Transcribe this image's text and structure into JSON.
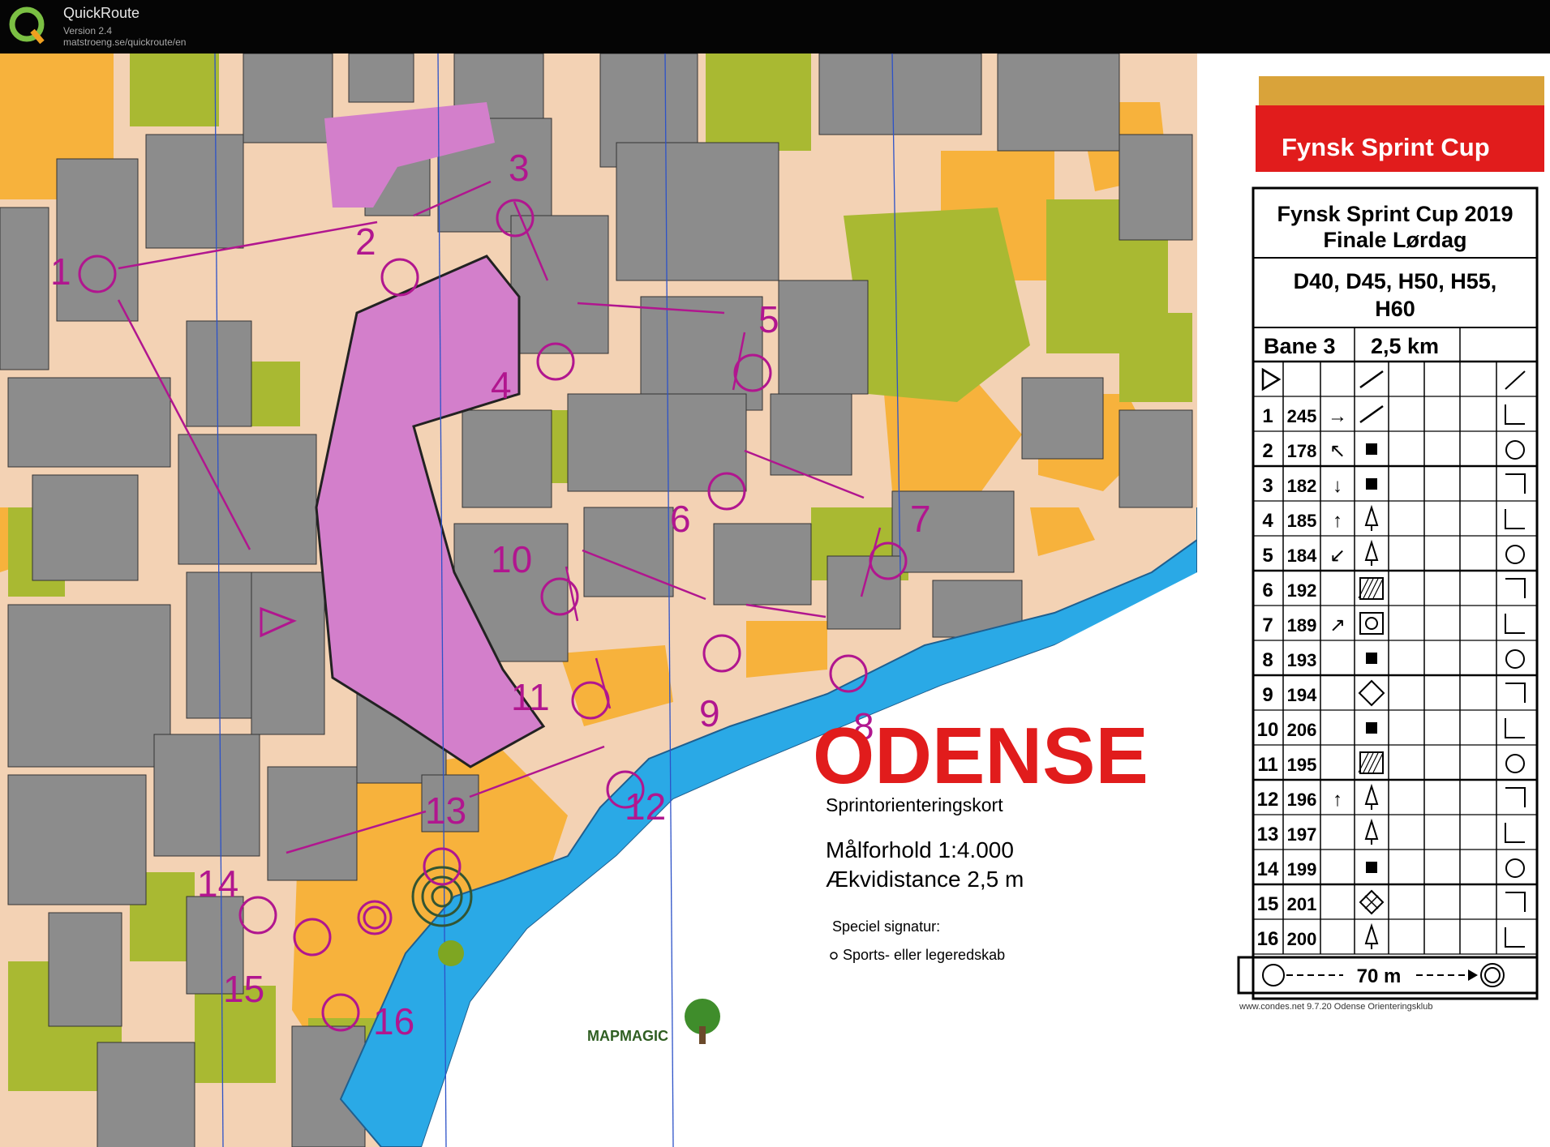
{
  "window": {
    "title": "QuickRoute",
    "version": "Version 2.4",
    "url": "matstroeng.se/quickroute/en"
  },
  "map": {
    "banner": "Fynsk Sprint Cup",
    "event_title_1": "Fynsk Sprint Cup 2019",
    "event_title_2": "Finale Lørdag",
    "classes_1": "D40, D45, H50, H55,",
    "classes_2": "H60",
    "course_name": "Bane 3",
    "course_length": "2,5 km",
    "city": "ODENSE",
    "map_type": "Sprintorienteringskort",
    "scale": "Målforhold 1:4.000",
    "contour": "Ækvidistance 2,5 m",
    "special_symbol_title": "Speciel signatur:",
    "special_symbol_desc": "Sports- eller legeredskab",
    "footer": "www.condes.net 9.7.20 Odense Orienteringsklub",
    "finish_distance": "70 m",
    "mapper_logo": "MAPMAGIC",
    "controls": [
      {
        "n": "1",
        "code": "245"
      },
      {
        "n": "2",
        "code": "178"
      },
      {
        "n": "3",
        "code": "182"
      },
      {
        "n": "4",
        "code": "185"
      },
      {
        "n": "5",
        "code": "184"
      },
      {
        "n": "6",
        "code": "192"
      },
      {
        "n": "7",
        "code": "189"
      },
      {
        "n": "8",
        "code": "193"
      },
      {
        "n": "9",
        "code": "194"
      },
      {
        "n": "10",
        "code": "206"
      },
      {
        "n": "11",
        "code": "195"
      },
      {
        "n": "12",
        "code": "196"
      },
      {
        "n": "13",
        "code": "197"
      },
      {
        "n": "14",
        "code": "199"
      },
      {
        "n": "15",
        "code": "201"
      },
      {
        "n": "16",
        "code": "200"
      }
    ],
    "colors": {
      "building": "#8c8c8c",
      "paved": "#f3d2b4",
      "open": "#f7b23c",
      "green": "#a9b932",
      "water": "#2aa9e6",
      "restricted": "#d37fcb",
      "course": "#b1168f",
      "banner_red": "#e11c1c"
    }
  }
}
